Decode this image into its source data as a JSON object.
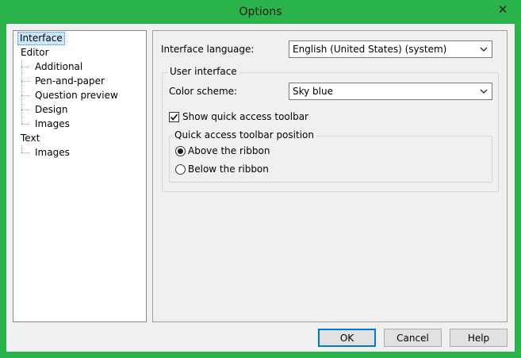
{
  "window": {
    "title": "Options",
    "close_glyph": "✕"
  },
  "tree": {
    "items": [
      {
        "label": "Interface"
      },
      {
        "label": "Editor"
      },
      {
        "label": "Additional"
      },
      {
        "label": "Pen-and-paper"
      },
      {
        "label": "Question preview"
      },
      {
        "label": "Design"
      },
      {
        "label": "Images"
      },
      {
        "label": "Text"
      },
      {
        "label": "Images"
      }
    ]
  },
  "panel": {
    "language_label": "Interface language:",
    "language_value": "English (United States) (system)",
    "user_interface_group": "User interface",
    "color_scheme_label": "Color scheme:",
    "color_scheme_value": "Sky blue",
    "show_toolbar_label": "Show quick access toolbar",
    "show_toolbar_checked": true,
    "toolbar_position_group": "Quick access toolbar position",
    "above_label": "Above the ribbon",
    "below_label": "Below the ribbon",
    "selected_position": "above"
  },
  "buttons": {
    "ok": "OK",
    "cancel": "Cancel",
    "help": "Help"
  },
  "colors": {
    "titlebar": "#2bb34b",
    "selection": "#cce8ff",
    "default_button_border": "#0078d7"
  }
}
